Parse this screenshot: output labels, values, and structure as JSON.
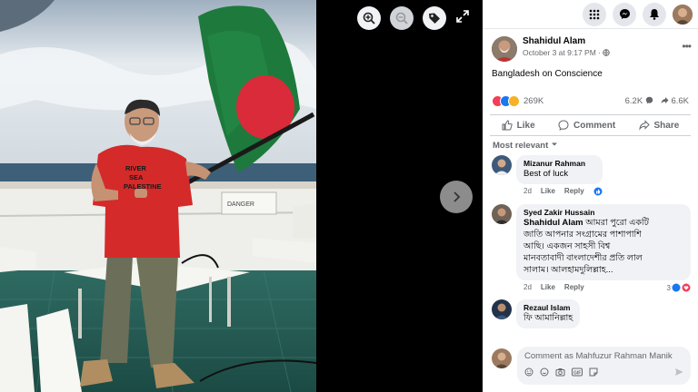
{
  "viewer": {
    "icons": [
      "zoom-in-icon",
      "zoom-out-icon",
      "tag-icon",
      "expand-icon",
      "chevron-right-icon"
    ]
  },
  "photo": {
    "shirt_text_line1": "RIVER",
    "shirt_text_line2": "SEA",
    "shirt_text_line3": "PALESTINE",
    "sign_text": "DANGER"
  },
  "topbar": {
    "icons": [
      "menu-grid-icon",
      "messenger-icon",
      "notifications-bell-icon",
      "profile-avatar"
    ]
  },
  "post": {
    "author": "Shahidul Alam",
    "date": "October 3 at 9:17 PM ·",
    "privacy_icon": "globe-icon",
    "caption": "Bangladesh on Conscience",
    "reaction_count": "269K",
    "comment_count": "6.2K",
    "share_count": "6.6K",
    "colors": {
      "like": "#1877f2",
      "love": "#f33e58",
      "care": "#f7b125"
    }
  },
  "actions": {
    "like": "Like",
    "comment": "Comment",
    "share": "Share"
  },
  "sort": {
    "label": "Most relevant"
  },
  "comments": [
    {
      "name": "Mizanur Rahman",
      "text": "Best of luck",
      "time": "2d",
      "like": "Like",
      "reply": "Reply"
    },
    {
      "name": "Syed Zakir Hussain",
      "tag": "Shahidul Alam",
      "text_line1": "আমরা পুরো একটি",
      "text_line2": "জাতি আপনার সংগ্রামের পাশাপাশি",
      "text_line3": "আছি। একজন সাহসী বিশ্ব",
      "text_line4": "মানবতাবাদী বাংলাদেশীর প্রতি লাল",
      "text_line5": "সালাম। আলহামদুলিল্লাহ...",
      "time": "2d",
      "like": "Like",
      "reply": "Reply",
      "reactions": "3"
    },
    {
      "name": "Rezaul Islam",
      "text": "ফি আমানিল্লাহ"
    }
  ],
  "composer": {
    "placeholder": "Comment as Mahfuzur Rahman Manik",
    "icons": [
      "emoji-icon",
      "camera-icon",
      "gif-icon",
      "sticker-icon",
      "send-icon"
    ]
  }
}
